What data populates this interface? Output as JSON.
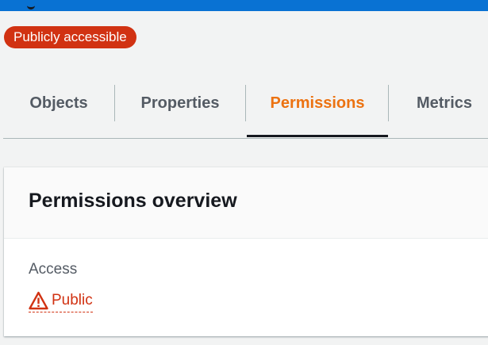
{
  "header": {
    "status_badge": "Publicly accessible"
  },
  "tabs": [
    {
      "label": "Objects",
      "active": false
    },
    {
      "label": "Properties",
      "active": false
    },
    {
      "label": "Permissions",
      "active": true
    },
    {
      "label": "Metrics",
      "active": false
    }
  ],
  "permissions_overview": {
    "title": "Permissions overview",
    "access_label": "Access",
    "access_value": "Public",
    "access_icon": "warning-icon"
  },
  "colors": {
    "accent_active_tab": "#ec7211",
    "danger": "#d13212",
    "top_bar": "#0972d3"
  }
}
